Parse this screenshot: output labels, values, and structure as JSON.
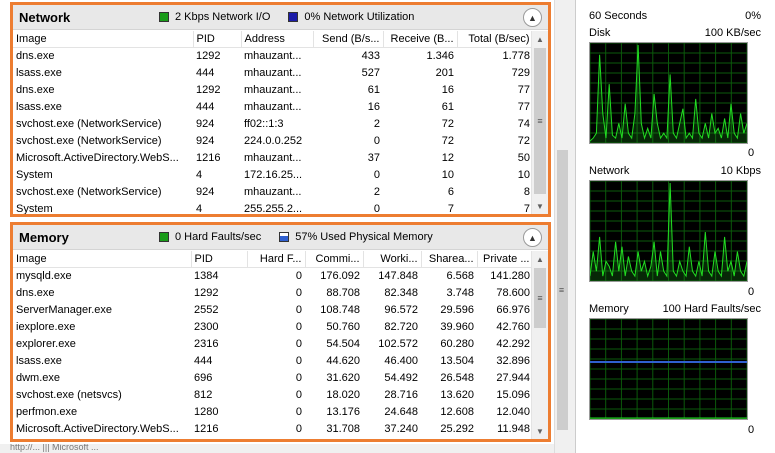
{
  "network": {
    "title": "Network",
    "legend1": "2 Kbps Network I/O",
    "legend1_color": "#1a9c1a",
    "legend2": "0% Network Utilization",
    "legend2_color": "#1c1ca8",
    "columns": [
      "Image",
      "PID",
      "Address",
      "Send (B/s...",
      "Receive (B...",
      "Total (B/sec)"
    ],
    "rows": [
      [
        "dns.exe",
        "1292",
        "mhauzant...",
        "433",
        "1.346",
        "1.778"
      ],
      [
        "lsass.exe",
        "444",
        "mhauzant...",
        "527",
        "201",
        "729"
      ],
      [
        "dns.exe",
        "1292",
        "mhauzant...",
        "61",
        "16",
        "77"
      ],
      [
        "lsass.exe",
        "444",
        "mhauzant...",
        "16",
        "61",
        "77"
      ],
      [
        "svchost.exe (NetworkService)",
        "924",
        "ff02::1:3",
        "2",
        "72",
        "74"
      ],
      [
        "svchost.exe (NetworkService)",
        "924",
        "224.0.0.252",
        "0",
        "72",
        "72"
      ],
      [
        "Microsoft.ActiveDirectory.WebS...",
        "1216",
        "mhauzant...",
        "37",
        "12",
        "50"
      ],
      [
        "System",
        "4",
        "172.16.25...",
        "0",
        "10",
        "10"
      ],
      [
        "svchost.exe (NetworkService)",
        "924",
        "mhauzant...",
        "2",
        "6",
        "8"
      ],
      [
        "System",
        "4",
        "255.255.2...",
        "0",
        "7",
        "7"
      ]
    ]
  },
  "memory": {
    "title": "Memory",
    "legend1": "0 Hard Faults/sec",
    "legend1_color": "#1a9c1a",
    "legend2": "57% Used Physical Memory",
    "legend2_color": "#3060d0",
    "columns": [
      "Image",
      "PID",
      "Hard F...",
      "Commi...",
      "Worki...",
      "Sharea...",
      "Private ..."
    ],
    "rows": [
      [
        "mysqld.exe",
        "1384",
        "0",
        "176.092",
        "147.848",
        "6.568",
        "141.280"
      ],
      [
        "dns.exe",
        "1292",
        "0",
        "88.708",
        "82.348",
        "3.748",
        "78.600"
      ],
      [
        "ServerManager.exe",
        "2552",
        "0",
        "108.748",
        "96.572",
        "29.596",
        "66.976"
      ],
      [
        "iexplore.exe",
        "2300",
        "0",
        "50.760",
        "82.720",
        "39.960",
        "42.760"
      ],
      [
        "explorer.exe",
        "2316",
        "0",
        "54.504",
        "102.572",
        "60.280",
        "42.292"
      ],
      [
        "lsass.exe",
        "444",
        "0",
        "44.620",
        "46.400",
        "13.504",
        "32.896"
      ],
      [
        "dwm.exe",
        "696",
        "0",
        "31.620",
        "54.492",
        "26.548",
        "27.944"
      ],
      [
        "svchost.exe (netsvcs)",
        "812",
        "0",
        "18.020",
        "28.716",
        "13.620",
        "15.096"
      ],
      [
        "perfmon.exe",
        "1280",
        "0",
        "13.176",
        "24.648",
        "12.608",
        "12.040"
      ],
      [
        "Microsoft.ActiveDirectory.WebS...",
        "1216",
        "0",
        "31.708",
        "37.240",
        "25.292",
        "11.948"
      ]
    ]
  },
  "graphs": {
    "top": {
      "left": "60 Seconds",
      "right": "0%"
    },
    "disk": {
      "title": "Disk",
      "scale": "100 KB/sec",
      "zero": "0",
      "values": [
        0.02,
        0.05,
        0.1,
        0.9,
        0.3,
        0.05,
        0.6,
        0.08,
        0.05,
        0.2,
        0.05,
        0.4,
        0.1,
        0.05,
        0.3,
        1.0,
        0.2,
        0.05,
        0.15,
        0.05,
        0.5,
        0.2,
        0.05,
        0.1,
        0.05,
        0.7,
        0.1,
        0.05,
        0.2,
        0.35,
        0.05,
        0.1,
        0.05,
        0.45,
        0.1,
        0.05,
        0.2,
        0.05,
        0.3,
        0.1,
        0.15,
        0.05,
        0.25,
        0.05,
        0.4,
        0.1,
        0.05,
        0.3,
        0.1,
        0.2
      ]
    },
    "network": {
      "title": "Network",
      "scale": "10 Kbps",
      "zero": "0",
      "values": [
        0.05,
        0.3,
        0.1,
        0.45,
        0.05,
        0.2,
        0.15,
        0.05,
        0.4,
        0.1,
        0.35,
        0.05,
        0.25,
        0.1,
        0.05,
        0.3,
        0.1,
        0.2,
        0.05,
        0.15,
        0.4,
        0.05,
        0.3,
        0.1,
        0.05,
        1.0,
        0.1,
        0.05,
        0.2,
        0.1,
        0.05,
        0.35,
        0.1,
        0.05,
        0.2,
        0.05,
        0.5,
        0.1,
        0.05,
        0.3,
        0.1,
        0.05,
        0.45,
        0.1,
        0.2,
        0.05,
        0.3,
        0.1,
        0.05,
        0.2
      ]
    },
    "memory": {
      "title": "Memory",
      "scale": "100 Hard Faults/sec",
      "zero": "0",
      "used_fraction": 0.57
    }
  },
  "status_strip": "http://...  |||  Microsoft ..."
}
